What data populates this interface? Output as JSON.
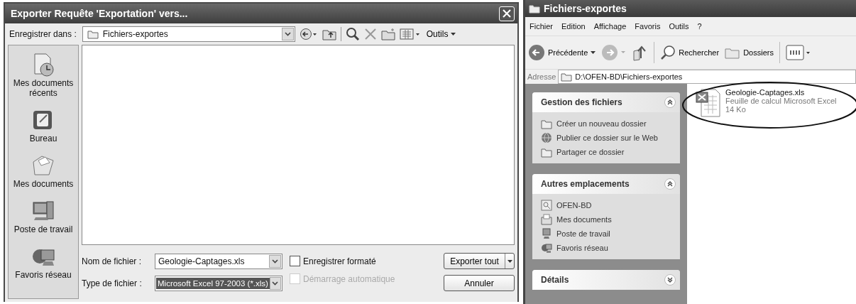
{
  "dialog": {
    "title": "Exporter Requête 'Exportation' vers...",
    "save_in_label": "Enregistrer dans :",
    "save_in_value": "Fichiers-exportes",
    "tools_menu": "Outils",
    "places": [
      {
        "label": "Mes documents récents"
      },
      {
        "label": "Bureau"
      },
      {
        "label": "Mes documents"
      },
      {
        "label": "Poste de travail"
      },
      {
        "label": "Favoris réseau"
      }
    ],
    "filename_label": "Nom de fichier :",
    "filename_value": "Geologie-Captages.xls",
    "filetype_label": "Type de fichier :",
    "filetype_value": "Microsoft Excel 97-2003 (*.xls)",
    "options": [
      {
        "label": "Enregistrer formaté",
        "checked": false,
        "disabled": false
      },
      {
        "label": "Démarrage automatique",
        "checked": false,
        "disabled": true
      }
    ],
    "buttons": [
      {
        "label": "Exporter tout",
        "kind": "split"
      },
      {
        "label": "Annuler",
        "kind": "plain"
      }
    ]
  },
  "explorer": {
    "title": "Fichiers-exportes",
    "menu": [
      "Fichier",
      "Edition",
      "Affichage",
      "Favoris",
      "Outils",
      "?"
    ],
    "toolbar": {
      "back": "Précédente",
      "search": "Rechercher",
      "folders": "Dossiers"
    },
    "address_label": "Adresse",
    "address_value": "D:\\OFEN-BD\\Fichiers-exportes",
    "panels": [
      {
        "title": "Gestion des fichiers",
        "expanded": true,
        "items": [
          "Créer un nouveau dossier",
          "Publier ce dossier sur le Web",
          "Partager ce dossier"
        ]
      },
      {
        "title": "Autres emplacements",
        "expanded": true,
        "items": [
          "OFEN-BD",
          "Mes documents",
          "Poste de travail",
          "Favoris réseau"
        ]
      },
      {
        "title": "Détails",
        "expanded": false
      }
    ],
    "files": [
      {
        "name": "Geologie-Captages.xls",
        "type": "Feuille de calcul Microsoft Excel",
        "size": "14 Ko"
      }
    ]
  }
}
